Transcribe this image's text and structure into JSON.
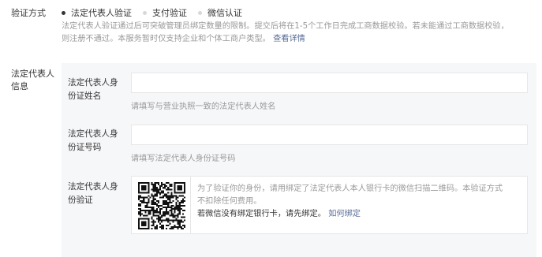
{
  "verify": {
    "label": "验证方式",
    "options": [
      {
        "label": "法定代表人验证",
        "checked": true
      },
      {
        "label": "支付验证",
        "checked": false
      },
      {
        "label": "微信认证",
        "checked": false
      }
    ],
    "description_line1": "法定代表人验证通过后可突破管理员绑定数量的限制。提交后将在1-5个工作日完成工商数据校验。若未能通过工商数据校验，",
    "description_line2": "则注册不通过。本服务暂时仅支持企业和个体工商户类型。",
    "description_link": "查看详情"
  },
  "rep": {
    "label": "法定代表人信息",
    "name_field": {
      "label": "法定代表人身份证姓名",
      "value": "",
      "tip": "请填写与营业执照一致的法定代表人姓名"
    },
    "id_field": {
      "label": "法定代表人身份证号码",
      "value": "",
      "tip": "请填写法定代表人身份证号码"
    },
    "identity": {
      "label": "法定代表人身份验证",
      "text_line1": "为了验证你的身份，请用绑定了法定代表人本人银行卡的微信扫描二维码。本验证方式",
      "text_line2": "不扣除任何费用。",
      "text_line3": "若微信没有绑定银行卡，请先绑定。",
      "link": "如何绑定"
    }
  },
  "colors": {
    "link": "#576b95",
    "tip": "#9a9a9a",
    "panel_bg": "#f6f7f9",
    "text": "#353535"
  }
}
